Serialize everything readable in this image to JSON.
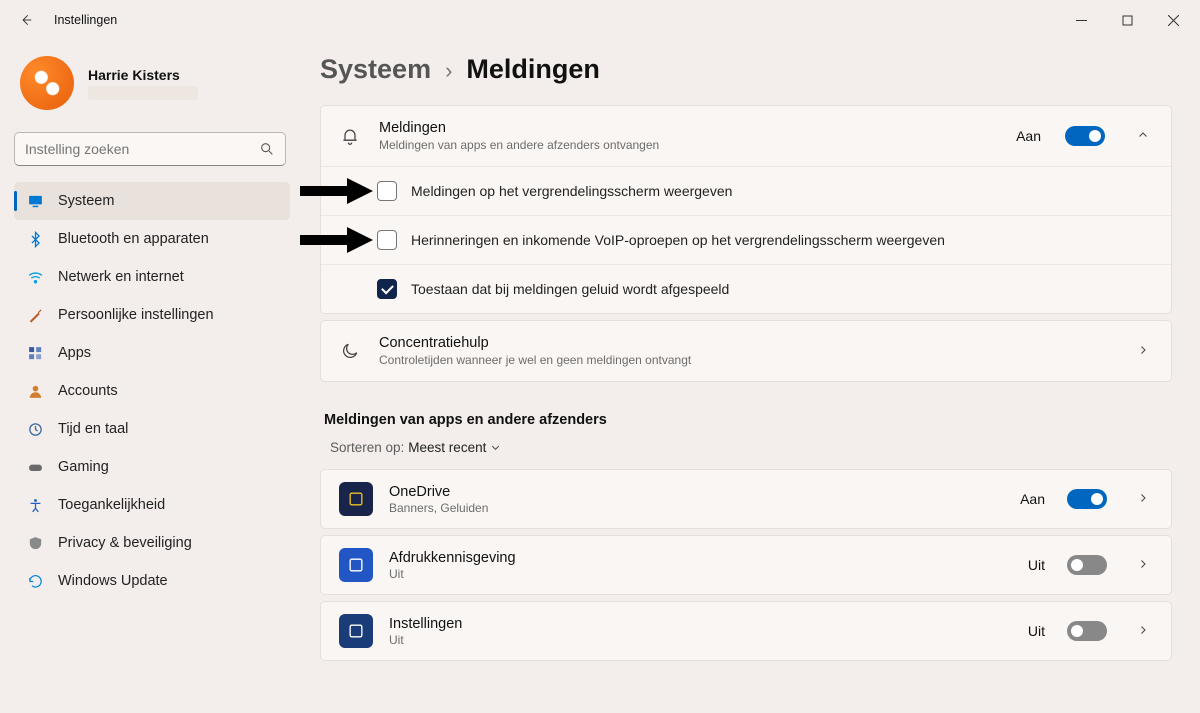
{
  "window": {
    "title": "Instellingen"
  },
  "profile": {
    "name": "Harrie Kisters"
  },
  "search": {
    "placeholder": "Instelling zoeken"
  },
  "sidebar": {
    "items": [
      {
        "label": "Systeem",
        "icon": "monitor",
        "color": "#0078d4",
        "active": true
      },
      {
        "label": "Bluetooth en apparaten",
        "icon": "bluetooth",
        "color": "#0078d4"
      },
      {
        "label": "Netwerk en internet",
        "icon": "wifi",
        "color": "#00a0e4"
      },
      {
        "label": "Persoonlijke instellingen",
        "icon": "brush",
        "color": "#b85c2c"
      },
      {
        "label": "Apps",
        "icon": "apps",
        "color": "#506090"
      },
      {
        "label": "Accounts",
        "icon": "person",
        "color": "#d08030"
      },
      {
        "label": "Tijd en taal",
        "icon": "globe-clock",
        "color": "#3c6aa0"
      },
      {
        "label": "Gaming",
        "icon": "gamepad",
        "color": "#6a6a6a"
      },
      {
        "label": "Toegankelijkheid",
        "icon": "accessibility",
        "color": "#2060c0"
      },
      {
        "label": "Privacy & beveiliging",
        "icon": "shield",
        "color": "#8a8a8a"
      },
      {
        "label": "Windows Update",
        "icon": "update",
        "color": "#0888d8"
      }
    ]
  },
  "breadcrumb": {
    "parent": "Systeem",
    "current": "Meldingen"
  },
  "notifications_card": {
    "title": "Meldingen",
    "subtitle": "Meldingen van apps en andere afzenders ontvangen",
    "state": "Aan",
    "on": true,
    "options": [
      {
        "label": "Meldingen op het vergrendelingsscherm weergeven",
        "checked": false,
        "arrow": true
      },
      {
        "label": "Herinneringen en inkomende VoIP-oproepen op het vergrendelingsscherm weergeven",
        "checked": false,
        "arrow": true
      },
      {
        "label": "Toestaan dat bij meldingen geluid wordt afgespeeld",
        "checked": true,
        "arrow": false
      }
    ]
  },
  "focus_card": {
    "title": "Concentratiehulp",
    "subtitle": "Controletijden wanneer je wel en geen meldingen ontvangt"
  },
  "apps_section": {
    "title": "Meldingen van apps en andere afzenders",
    "sort_label": "Sorteren op:",
    "sort_value": "Meest recent",
    "apps": [
      {
        "name": "OneDrive",
        "sub": "Banners, Geluiden",
        "state": "Aan",
        "on": true,
        "icon_bg": "#18244a",
        "icon_fg": "#f0c020"
      },
      {
        "name": "Afdrukkennisgeving",
        "sub": "Uit",
        "state": "Uit",
        "on": false,
        "icon_bg": "#2256c5",
        "icon_fg": "#ffffff"
      },
      {
        "name": "Instellingen",
        "sub": "Uit",
        "state": "Uit",
        "on": false,
        "icon_bg": "#1a3c78",
        "icon_fg": "#ffffff"
      }
    ]
  }
}
